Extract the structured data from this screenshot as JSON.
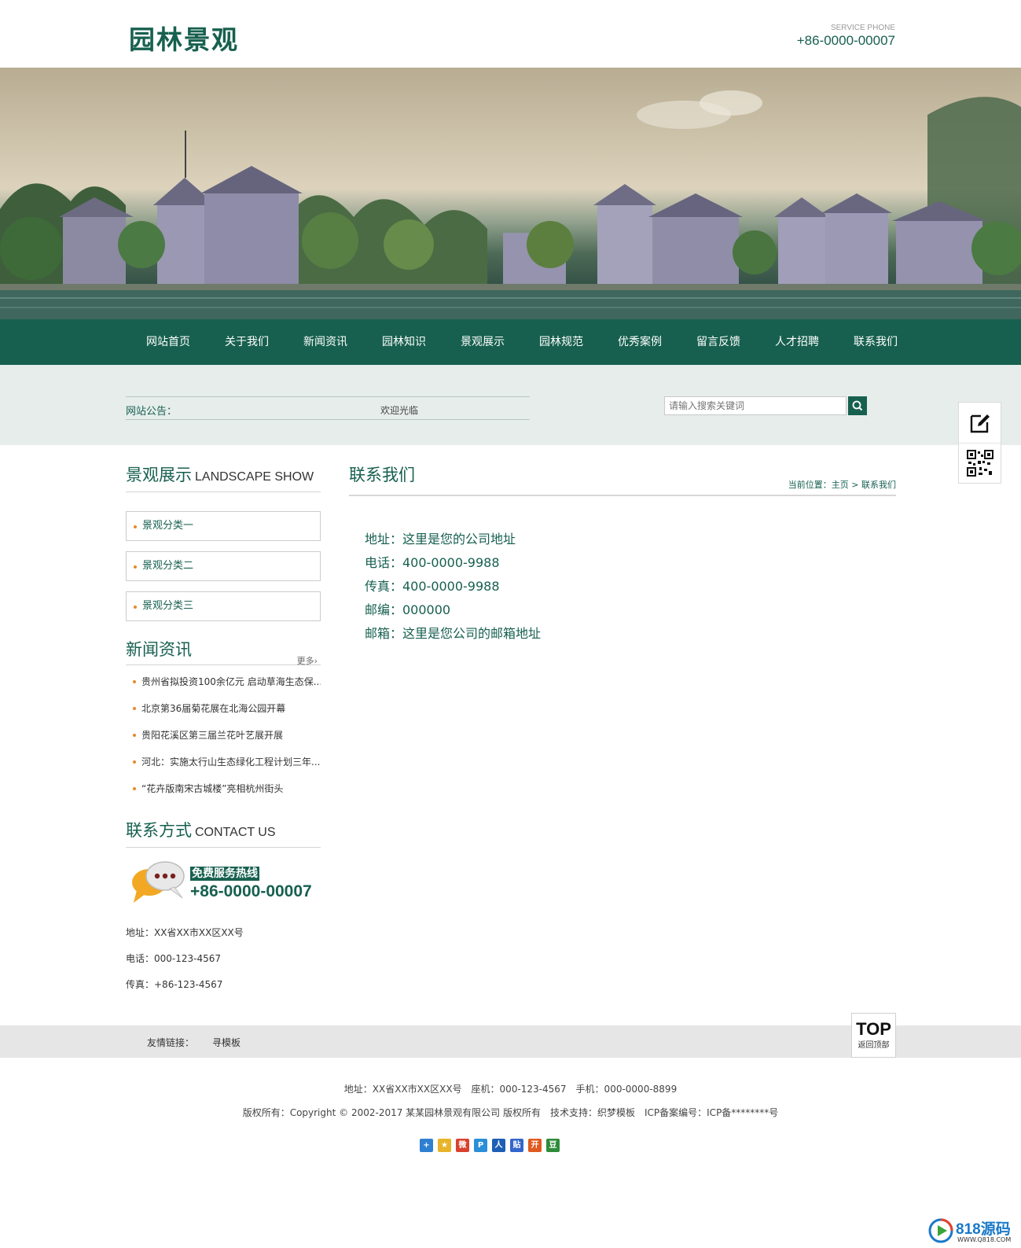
{
  "header": {
    "logo": "园林景观",
    "phone_label": "SERVICE PHONE",
    "phone": "+86-0000-00007"
  },
  "nav": [
    {
      "label": "网站首页"
    },
    {
      "label": "关于我们"
    },
    {
      "label": "新闻资讯"
    },
    {
      "label": "园林知识"
    },
    {
      "label": "景观展示"
    },
    {
      "label": "园林规范"
    },
    {
      "label": "优秀案例"
    },
    {
      "label": "留言反馈"
    },
    {
      "label": "人才招聘"
    },
    {
      "label": "联系我们"
    }
  ],
  "notice": {
    "label": "网站公告：",
    "text": "欢迎光临"
  },
  "search": {
    "placeholder": "请输入搜索关键词"
  },
  "sidebar": {
    "landscape": {
      "title_cn": "景观展示",
      "title_en": "LANDSCAPE SHOW",
      "items": [
        {
          "label": "景观分类一"
        },
        {
          "label": "景观分类二"
        },
        {
          "label": "景观分类三"
        }
      ]
    },
    "news": {
      "title_cn": "新闻资讯",
      "more": "更多›",
      "items": [
        {
          "title": "贵州省拟投资100余亿元 启动草海生态保..."
        },
        {
          "title": "北京第36届菊花展在北海公园开幕"
        },
        {
          "title": "贵阳花溪区第三届兰花叶艺展开展"
        },
        {
          "title": "河北：实施太行山生态绿化工程计划三年..."
        },
        {
          "title": "“花卉版南宋古城楼”亮相杭州街头"
        }
      ]
    },
    "contact": {
      "title_cn": "联系方式",
      "title_en": "CONTACT US",
      "hotline_label": "免费服务热线",
      "hotline": "+86-0000-00007",
      "address": "地址：XX省XX市XX区XX号",
      "tel": "电话：000-123-4567",
      "fax": "传真：+86-123-4567"
    }
  },
  "main": {
    "title": "联系我们",
    "breadcrumb": "当前位置：主页 > 联系我们",
    "lines": [
      {
        "text": "地址：这里是您的公司地址"
      },
      {
        "text": "电话：400-0000-9988"
      },
      {
        "text": "传真：400-0000-9988"
      },
      {
        "text": "邮编：000000"
      },
      {
        "text": "邮箱：这里是您公司的邮箱地址"
      }
    ]
  },
  "links": {
    "label": "友情链接：",
    "items": [
      {
        "label": "寻模板"
      }
    ]
  },
  "top_button": {
    "label": "TOP",
    "sub": "返回顶部"
  },
  "footer": {
    "line1": "地址：XX省XX市XX区XX号　座机：000-123-4567　手机：000-0000-8899",
    "line2": "版权所有：Copyright © 2002-2017 某某园林景观有限公司 版权所有　技术支持：织梦模板　ICP备案编号：ICP备********号"
  },
  "share_icons": [
    {
      "name": "share-more-icon",
      "glyph": "+",
      "color": "#2f7fd1"
    },
    {
      "name": "qzone-icon",
      "glyph": "★",
      "color": "#e8b42a"
    },
    {
      "name": "weibo-icon",
      "glyph": "微",
      "color": "#d9412f"
    },
    {
      "name": "tencent-weibo-icon",
      "glyph": "P",
      "color": "#2b8fd8"
    },
    {
      "name": "renren-icon",
      "glyph": "人",
      "color": "#1c5fb5"
    },
    {
      "name": "tieba-icon",
      "glyph": "贴",
      "color": "#3366cc"
    },
    {
      "name": "kaixin-icon",
      "glyph": "开",
      "color": "#e05a1f"
    },
    {
      "name": "douban-icon",
      "glyph": "豆",
      "color": "#2e8b3a"
    }
  ],
  "watermark": {
    "text": "818源码",
    "sub": "WWW.Q818.COM"
  },
  "colors": {
    "brand_green": "#17604f",
    "accent_orange": "#e6892a"
  }
}
